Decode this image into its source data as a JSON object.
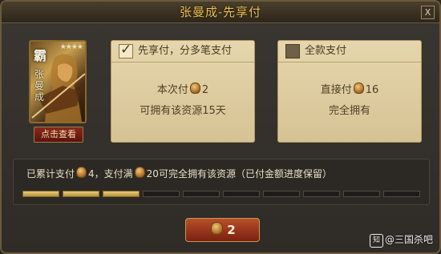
{
  "dialog": {
    "title": "张曼成-先享付",
    "close_label": "X"
  },
  "hero": {
    "name": "张曼成",
    "glyph": "霸",
    "stars": "★★★★",
    "view_button": "点击查看"
  },
  "options": [
    {
      "label": "先享付，分多笔支付",
      "checked": true,
      "line1_prefix": "本次付",
      "line1_amount": "2",
      "line2": "可拥有该资源15天"
    },
    {
      "label": "全款支付",
      "checked": false,
      "line1_prefix": "直接付",
      "line1_amount": "16",
      "line2": "完全拥有"
    }
  ],
  "progress": {
    "text_a": "已累计支付",
    "paid": "4",
    "text_b": "，支付满",
    "total": "20",
    "text_c": "可完全拥有该资源（已付金额进度保留）",
    "segments_total": 10,
    "segments_filled": 3
  },
  "pay_button": {
    "amount": "2"
  },
  "watermark": {
    "logo": "知",
    "text": "@三国杀吧"
  },
  "icons": {
    "currency": "coin-pouch-icon",
    "check": "check-icon",
    "close": "close-icon"
  }
}
